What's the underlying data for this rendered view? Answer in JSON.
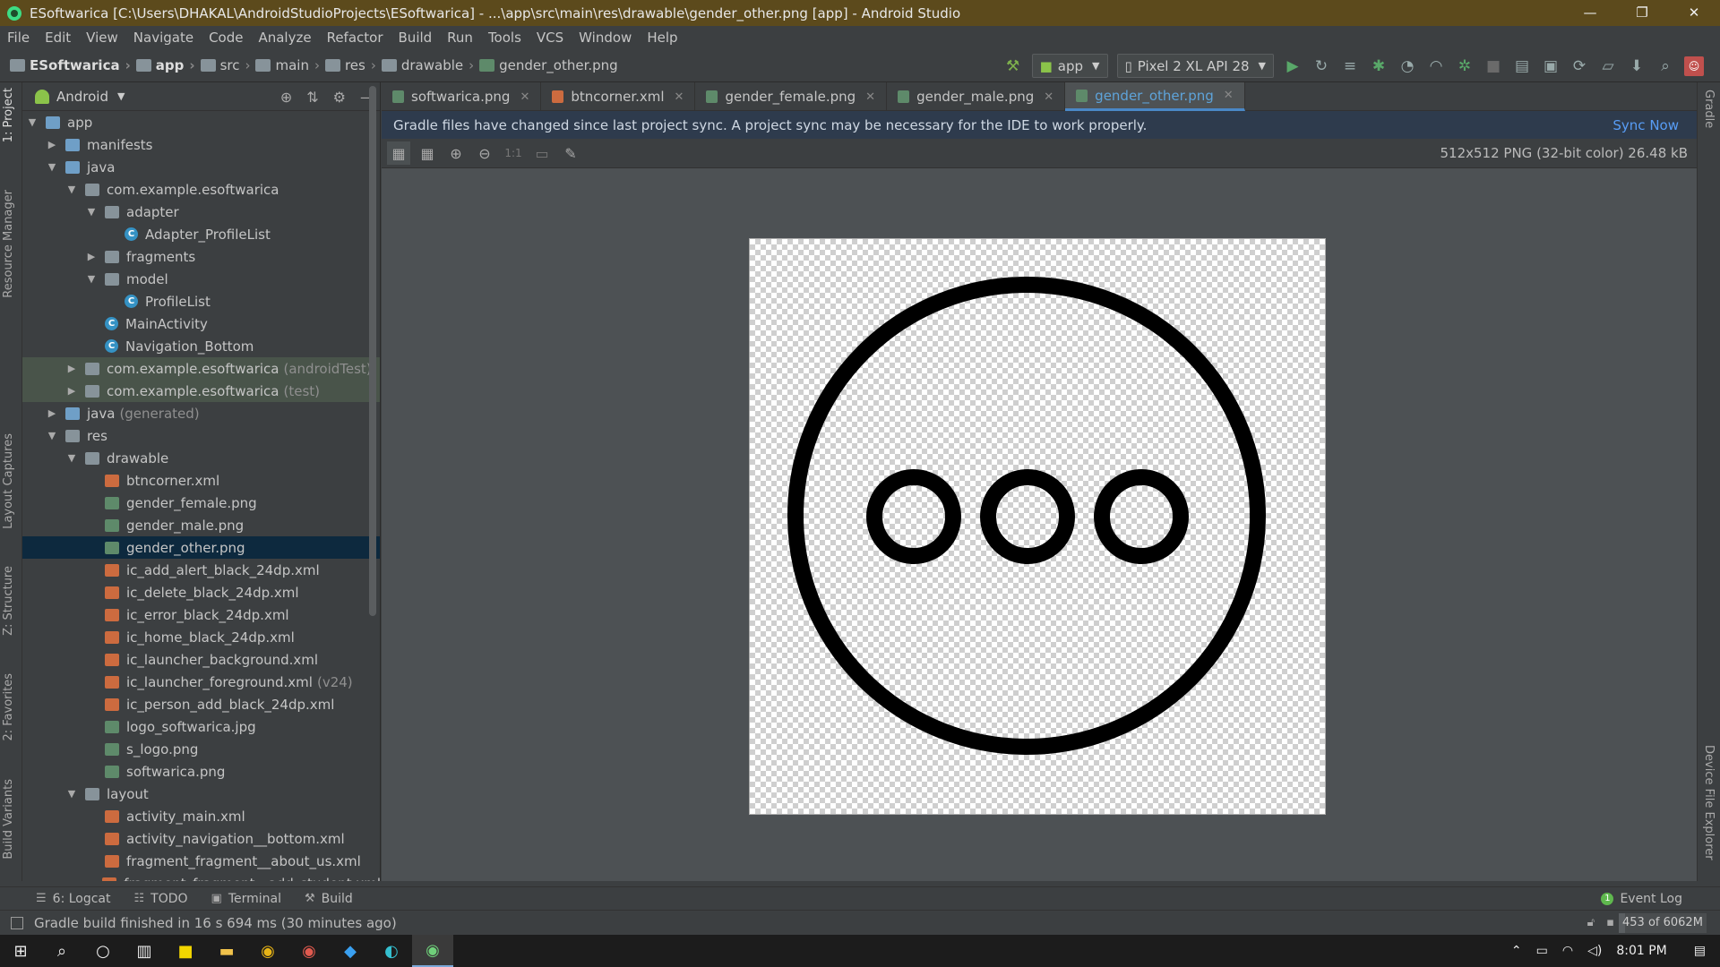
{
  "window": {
    "title": "ESoftwarica [C:\\Users\\DHAKAL\\AndroidStudioProjects\\ESoftwarica] - ...\\app\\src\\main\\res\\drawable\\gender_other.png [app] - Android Studio",
    "minimize": "—",
    "maximize": "❐",
    "close": "✕"
  },
  "menu": [
    "File",
    "Edit",
    "View",
    "Navigate",
    "Code",
    "Analyze",
    "Refactor",
    "Build",
    "Run",
    "Tools",
    "VCS",
    "Window",
    "Help"
  ],
  "breadcrumb": [
    "ESoftwarica",
    "app",
    "src",
    "main",
    "res",
    "drawable",
    "gender_other.png"
  ],
  "toolbar": {
    "run_config": "app",
    "device": "Pixel 2 XL API 28"
  },
  "side_tabs_left": [
    "1: Project",
    "Resource Manager",
    "Layout Captures",
    "Z: Structure",
    "2: Favorites",
    "Build Variants"
  ],
  "side_tabs_right": [
    "Gradle",
    "Device File Explorer"
  ],
  "project_panel": {
    "view": "Android",
    "tree": [
      {
        "label": "app",
        "indent": 0,
        "arrow": "▼",
        "icon": "folder-blue",
        "note": ""
      },
      {
        "label": "manifests",
        "indent": 1,
        "arrow": "▶",
        "icon": "folder-blue",
        "note": ""
      },
      {
        "label": "java",
        "indent": 1,
        "arrow": "▼",
        "icon": "folder-blue",
        "note": ""
      },
      {
        "label": "com.example.esoftwarica",
        "indent": 2,
        "arrow": "▼",
        "icon": "pkg",
        "note": ""
      },
      {
        "label": "adapter",
        "indent": 3,
        "arrow": "▼",
        "icon": "pkg",
        "note": ""
      },
      {
        "label": "Adapter_ProfileList",
        "indent": 4,
        "arrow": "",
        "icon": "cls",
        "note": ""
      },
      {
        "label": "fragments",
        "indent": 3,
        "arrow": "▶",
        "icon": "pkg",
        "note": ""
      },
      {
        "label": "model",
        "indent": 3,
        "arrow": "▼",
        "icon": "pkg",
        "note": ""
      },
      {
        "label": "ProfileList",
        "indent": 4,
        "arrow": "",
        "icon": "cls",
        "note": ""
      },
      {
        "label": "MainActivity",
        "indent": 3,
        "arrow": "",
        "icon": "cls",
        "note": ""
      },
      {
        "label": "Navigation_Bottom",
        "indent": 3,
        "arrow": "",
        "icon": "cls",
        "note": ""
      },
      {
        "label": "com.example.esoftwarica",
        "indent": 2,
        "arrow": "▶",
        "icon": "pkg",
        "note": "(androidTest)",
        "test": true
      },
      {
        "label": "com.example.esoftwarica",
        "indent": 2,
        "arrow": "▶",
        "icon": "pkg",
        "note": "(test)",
        "test": true
      },
      {
        "label": "java",
        "indent": 1,
        "arrow": "▶",
        "icon": "folder-blue",
        "note": "(generated)"
      },
      {
        "label": "res",
        "indent": 1,
        "arrow": "▼",
        "icon": "folder",
        "note": ""
      },
      {
        "label": "drawable",
        "indent": 2,
        "arrow": "▼",
        "icon": "folder",
        "note": ""
      },
      {
        "label": "btncorner.xml",
        "indent": 3,
        "arrow": "",
        "icon": "xml",
        "note": ""
      },
      {
        "label": "gender_female.png",
        "indent": 3,
        "arrow": "",
        "icon": "png",
        "note": ""
      },
      {
        "label": "gender_male.png",
        "indent": 3,
        "arrow": "",
        "icon": "png",
        "note": ""
      },
      {
        "label": "gender_other.png",
        "indent": 3,
        "arrow": "",
        "icon": "png",
        "note": "",
        "selected": true
      },
      {
        "label": "ic_add_alert_black_24dp.xml",
        "indent": 3,
        "arrow": "",
        "icon": "xml",
        "note": ""
      },
      {
        "label": "ic_delete_black_24dp.xml",
        "indent": 3,
        "arrow": "",
        "icon": "xml",
        "note": ""
      },
      {
        "label": "ic_error_black_24dp.xml",
        "indent": 3,
        "arrow": "",
        "icon": "xml",
        "note": ""
      },
      {
        "label": "ic_home_black_24dp.xml",
        "indent": 3,
        "arrow": "",
        "icon": "xml",
        "note": ""
      },
      {
        "label": "ic_launcher_background.xml",
        "indent": 3,
        "arrow": "",
        "icon": "xml",
        "note": ""
      },
      {
        "label": "ic_launcher_foreground.xml",
        "indent": 3,
        "arrow": "",
        "icon": "xml",
        "note": "(v24)"
      },
      {
        "label": "ic_person_add_black_24dp.xml",
        "indent": 3,
        "arrow": "",
        "icon": "xml",
        "note": ""
      },
      {
        "label": "logo_softwarica.jpg",
        "indent": 3,
        "arrow": "",
        "icon": "png",
        "note": ""
      },
      {
        "label": "s_logo.png",
        "indent": 3,
        "arrow": "",
        "icon": "png",
        "note": ""
      },
      {
        "label": "softwarica.png",
        "indent": 3,
        "arrow": "",
        "icon": "png",
        "note": ""
      },
      {
        "label": "layout",
        "indent": 2,
        "arrow": "▼",
        "icon": "folder",
        "note": ""
      },
      {
        "label": "activity_main.xml",
        "indent": 3,
        "arrow": "",
        "icon": "xml",
        "note": ""
      },
      {
        "label": "activity_navigation__bottom.xml",
        "indent": 3,
        "arrow": "",
        "icon": "xml",
        "note": ""
      },
      {
        "label": "fragment_fragment__about_us.xml",
        "indent": 3,
        "arrow": "",
        "icon": "xml",
        "note": ""
      },
      {
        "label": "fragment_fragment__add_student.xml",
        "indent": 3,
        "arrow": "",
        "icon": "xml",
        "note": ""
      }
    ]
  },
  "editor": {
    "tabs": [
      {
        "label": "softwarica.png",
        "icon": "png",
        "active": false
      },
      {
        "label": "btncorner.xml",
        "icon": "xml",
        "active": false
      },
      {
        "label": "gender_female.png",
        "icon": "png",
        "active": false
      },
      {
        "label": "gender_male.png",
        "icon": "png",
        "active": false
      },
      {
        "label": "gender_other.png",
        "icon": "png",
        "active": true
      }
    ],
    "banner_text": "Gradle files have changed since last project sync. A project sync may be necessary for the IDE to work properly.",
    "banner_action": "Sync Now",
    "image_info": "512x512 PNG (32-bit color) 26.48 kB",
    "zoom_actual_label": "1:1"
  },
  "bottom_tools": [
    "6: Logcat",
    "TODO",
    "Terminal",
    "Build"
  ],
  "event_log": {
    "label": "Event Log",
    "count": "1"
  },
  "status": {
    "message": "Gradle build finished in 16 s 694 ms (30 minutes ago)",
    "memory": "453 of 6062M",
    "memory_fraction": 0.075
  },
  "taskbar": {
    "time": "8:01 PM"
  },
  "colors": {
    "accent": "#4a88c7",
    "titlebar": "#5c4a1c",
    "banner": "#2e3b4d",
    "selection": "#0d293e"
  }
}
